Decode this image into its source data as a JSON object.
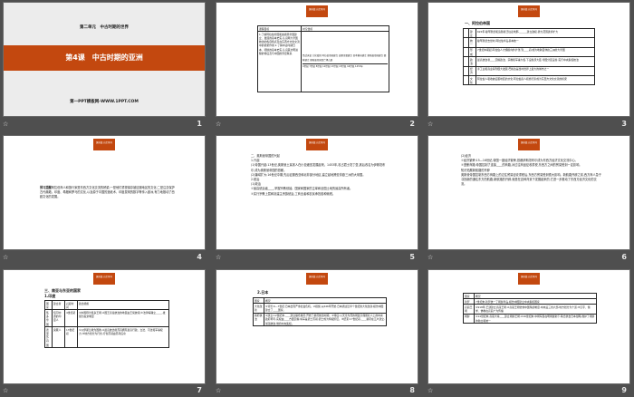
{
  "badge": "课前篇\n自主预习",
  "star_icon": "☆",
  "slides": [
    {
      "number": "1",
      "unit": "第二单元　中古时期的世界",
      "title": "第4课　中古时期的亚洲",
      "site": "第一PPT模板网-WWW.1PPT.COM"
    },
    {
      "number": "2",
      "col1": "课程目标",
      "col2": "时空坐标",
      "goals": "1.了解阿拉伯帝国和奥斯曼帝国建立、发展的基本史实,认识两大帝国统治的各自特点及在东西方文化交流中的桥梁作用 2.了解中古时期日本、朝鲜的基本史实,认识其文明进程的特征及与中国的紧密联系",
      "events": "圣武天皇 大化改新 阿拉伯帝国建立 高丽王朝建立 日本幕府建立 奥斯曼帝国建立 朝鲜建立 奥斯曼帝国灭亡拜占庭",
      "times": "4世纪 7世纪 8世纪 10世纪 13世纪 15世纪 16世纪 1453年"
    },
    {
      "number": "3",
      "heading": "一、阿拉伯帝国",
      "rows": [
        [
          "建立",
          "622年,穆罕默德和追随者迁往麦地那,______建立政权,势力范围逐步扩大"
        ],
        [
          "统一",
          "穆罕默德去世时,阿拉伯半岛基本统一"
        ],
        [
          "形成",
          "7世纪中期起,阿拉伯人大规模向外扩张,到____初,成为地跨亚非欧三洲的大帝国"
        ],
        [
          "政治",
          "最高统治者____掌握政治、宗教和军事大权,下设各部大臣,帝国分区设省,实行中央集权统治"
        ],
        [
          "经济",
          "手工业和商业得到很大发展,巴格达是当时世界上最大的城市之一"
        ],
        [
          "文化",
          "阿拉伯人吸收被征服地区的文化,阿拉伯商人和旅行家成为东西方文化交流的桥梁"
        ]
      ]
    },
    {
      "number": "4",
      "label": "预习提醒",
      "text": "阿拉伯商人和旅行家是东西方文化交流的桥梁;一是他们重视保存被征服地区的文化;二是注意保护古代典籍。印度、希腊和罗马的文化,以及源于中国的造纸术、印度发明的数字等传入欧洲,有力地推动了西欧文化的发展。"
    },
    {
      "number": "5",
      "lines": [
        "二、奥斯曼帝国的兴起",
        "1.兴起",
        "(1)帝国兴起:13世纪,奥斯曼土耳其人在小亚细亚发展起来。1453年,攻占君士坦丁堡,其后改名为伊斯坦布尔,成为奥斯曼帝国的首都。",
        "(2)疆域扩大:16世纪中期,先后征服西亚和北非部分地区,建立起地跨亚非欧三洲的大帝国。",
        "2.统治",
        "(1)政治",
        "①最高统治者____,掌握宗教领袖、国家和国家的主宰和全国土地的最高所有者。",
        "②实行宗教上层和封建主贵族统治,工商业者和农民承担各种赋税。"
      ]
    },
    {
      "number": "6",
      "lines": [
        "(2)经济",
        "①经济繁荣:15—16世纪,帝国一度经济繁荣,首都伊斯坦布尔成为东西方经济文化交流中心。",
        "②垄断商路:帝国控制了连接____的商路,对过往商品征收重税,东西方之间的贸易受到一定影响。"
      ],
      "sub": "知识拓展新航路的开辟",
      "para": "奥斯曼帝国控制东西方商路上的过往贸易征收重税后,东西方贸易受到很大影响。新航路开辟之前,西方商人急于寻找新的通往东方的航路,新航路的开辟,就是在这种背景下发展起来的,它进一步推动了东西方经济文化的交流。"
    },
    {
      "number": "7",
      "heading": "三、南亚与东亚的国家",
      "sub": "1.印度",
      "cols": [
        "国家",
        "建立者",
        "兴起时间",
        "政治措施"
      ],
      "rows": [
        [
          "笈多帝国",
          "恒河中游的印度人",
          "4世纪初",
          "①中国称为笈多王朝;②国王直接统治的地区由王侯统领;③法律等确立_____,发展为奴隶制度"
        ],
        [
          "德里苏丹国",
          "突厥人",
          "13世纪初",
          "①以伊斯兰教为国教;②最高统治者苏丹拥有最高行政、立法、司法和军事权力;③地方划分为行省,行省首领由苏丹任命"
        ]
      ]
    },
    {
      "number": "8",
      "sub": "2.日本",
      "cols": [
        "国家",
        "概况"
      ],
      "rows": [
        [
          "大化改新",
          "①背景:6—7世纪,日本出现严重社会危机。②措施:从646年开始,日本通过近半个世纪的大化改新,模仿中国建立了____国家。"
        ],
        [
          "幕府统治",
          "①建立:12世纪末,____建立镰仓幕府,开始了幕府统治时期。②特征:以天皇为首的朝廷只保留名义上的中央政府称号,实权由____方面掌握;将军是武士首领;武士成为特权阶层。③结束:17世纪初,____幕府在江户建立,加强统治,维持中央集权。"
        ]
      ]
    },
    {
      "number": "9",
      "cols": [
        "国家",
        "概况"
      ],
      "rows": [
        [
          "新罗",
          "7世纪末,新罗统一了朝鲜半岛,模仿中国建立中央集权国家"
        ],
        [
          "高丽王朝",
          "①918年,王建建立高丽王朝;②高丽王朝仿效中国隋唐制度,中央设三省六部,地方划分为十道;③汉字、儒学、佛教在高丽广为传播"
        ],
        [
          "朝鲜",
          "①14世纪末,高丽大将____建立朝鲜王朝;②16世纪末,中朝军民在明朝援助下,联合抗击日本侵略,维护了朝鲜的独立和统一"
        ]
      ]
    }
  ]
}
